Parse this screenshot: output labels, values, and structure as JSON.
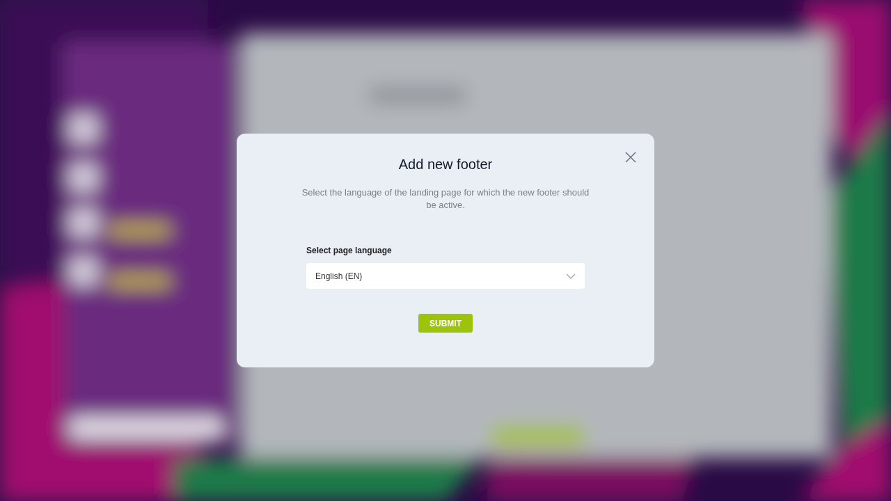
{
  "dialog": {
    "title": "Add new footer",
    "description": "Select the language of the landing page for which the new footer should be active.",
    "field": {
      "label": "Select page language",
      "value": "English (EN)"
    },
    "submit": "SUBMIT"
  }
}
